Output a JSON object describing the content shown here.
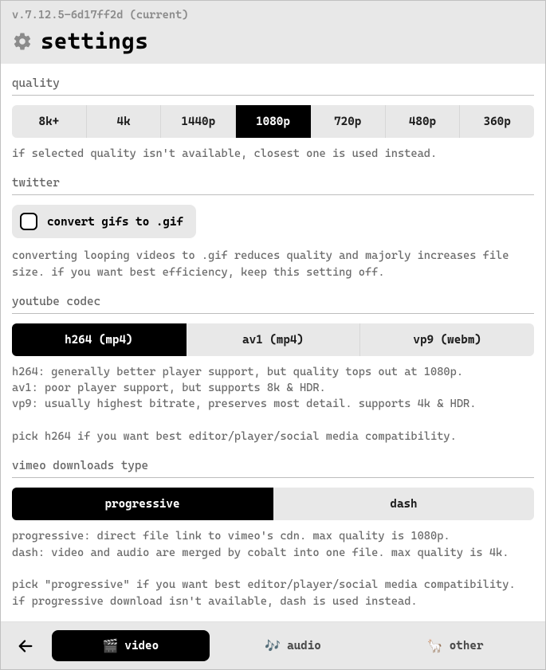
{
  "version": "v.7.12.5-6d17ff2d (current)",
  "title": "settings",
  "quality": {
    "label": "quality",
    "options": [
      "8k+",
      "4k",
      "1440p",
      "1080p",
      "720p",
      "480p",
      "360p"
    ],
    "selected": "1080p",
    "help": "if selected quality isn't available, closest one is used instead."
  },
  "twitter": {
    "label": "twitter",
    "gif_label": "convert gifs to .gif",
    "gif_checked": false,
    "help": "converting looping videos to .gif reduces quality and majorly increases file size. if you want best efficiency, keep this setting off."
  },
  "youtube": {
    "label": "youtube codec",
    "options": [
      "h264 (mp4)",
      "av1 (mp4)",
      "vp9 (webm)"
    ],
    "selected": "h264 (mp4)",
    "help": "h264: generally better player support, but quality tops out at 1080p.\nav1: poor player support, but supports 8k & HDR.\nvp9: usually highest bitrate, preserves most detail. supports 4k & HDR.\n\npick h264 if you want best editor/player/social media compatibility."
  },
  "vimeo": {
    "label": "vimeo downloads type",
    "options": [
      "progressive",
      "dash"
    ],
    "selected": "progressive",
    "help": "progressive: direct file link to vimeo's cdn. max quality is 1080p.\ndash: video and audio are merged by cobalt into one file. max quality is 4k.\n\npick \"progressive\" if you want best editor/player/social media compatibility. if progressive download isn't available, dash is used instead."
  },
  "tabs": {
    "items": [
      {
        "id": "video",
        "label": "video",
        "icon": "🎬"
      },
      {
        "id": "audio",
        "label": "audio",
        "icon": "🎶"
      },
      {
        "id": "other",
        "label": "other",
        "icon": "🦙"
      }
    ],
    "selected": "video"
  }
}
